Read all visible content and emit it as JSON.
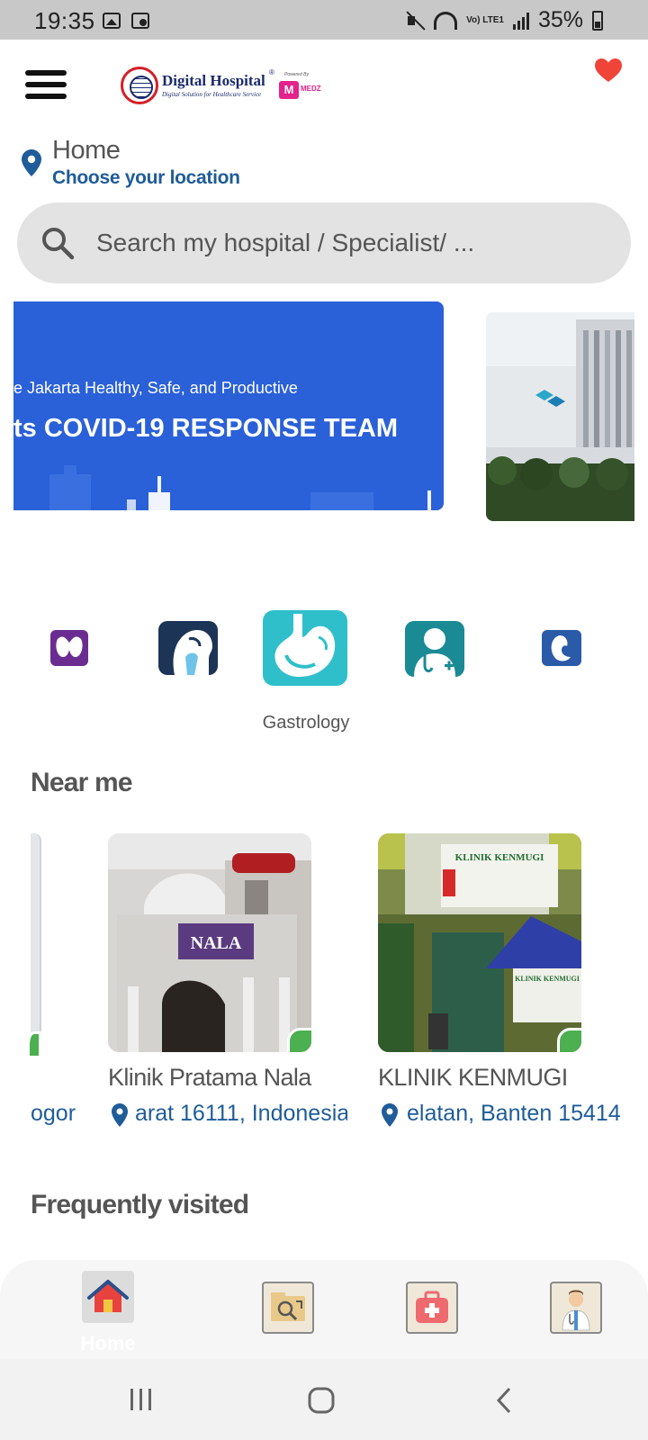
{
  "status_bar": {
    "time": "19:35",
    "network": "Vo) LTE1",
    "battery": "35%"
  },
  "header": {
    "logo_title": "Digital Hospital",
    "logo_reg": "®",
    "logo_tagline": "Digital Solution for Healthcare Service",
    "logo_powered": "Powered By",
    "logo_partner": "MEDZ"
  },
  "location": {
    "title": "Home",
    "subtitle": "Choose your location"
  },
  "search": {
    "placeholder": "Search my hospital / Specialist/ ..."
  },
  "banner": {
    "subtitle": "e Jakarta Healthy, Safe, and Productive",
    "title": "ts COVID-19 RESPONSE TEAM"
  },
  "categories": {
    "selected_label": "Gastrology",
    "items": [
      "thyroid-icon",
      "ent-icon",
      "stomach-icon",
      "doctor-icon",
      "fetus-icon"
    ]
  },
  "near_me": {
    "title": "Near me",
    "partial_addr": "ogor.",
    "cards": [
      {
        "name": "Klinik Pratama Nala",
        "address": "arat 16111, Indonesia"
      },
      {
        "name": "KLINIK KENMUGI",
        "address": "elatan, Banten 15414"
      }
    ]
  },
  "frequently_visited": {
    "title": "Frequently visited"
  },
  "bottom_nav": {
    "home_label": "Home"
  },
  "colors": {
    "accent_blue": "#1f5c99",
    "banner_blue": "#2a60d8",
    "heart_red": "#f04438"
  }
}
